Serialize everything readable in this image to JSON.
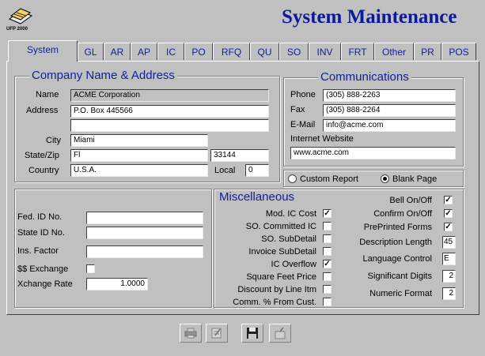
{
  "window": {
    "title": "System Maintenance",
    "logo_text": "UFP 2000"
  },
  "tabs": [
    {
      "label": "System",
      "active": true
    },
    {
      "label": "GL"
    },
    {
      "label": "AR"
    },
    {
      "label": "AP"
    },
    {
      "label": "IC"
    },
    {
      "label": "PO"
    },
    {
      "label": "RFQ"
    },
    {
      "label": "QU"
    },
    {
      "label": "SO"
    },
    {
      "label": "INV"
    },
    {
      "label": "FRT"
    },
    {
      "label": "Other"
    },
    {
      "label": "PR"
    },
    {
      "label": "POS"
    }
  ],
  "company": {
    "title": "Company Name & Address",
    "name_label": "Name",
    "name": "ACME Corporation",
    "address_label": "Address",
    "address1": "P.O. Box 445566",
    "address2": "",
    "city_label": "City",
    "city": "Miami",
    "statezip_label": "State/Zip",
    "state": "Fl",
    "zip": "33144",
    "country_label": "Country",
    "country": "U.S.A.",
    "local_label": "Local",
    "local": "0"
  },
  "communications": {
    "title": "Communications",
    "phone_label": "Phone",
    "phone": "(305) 888-2263",
    "fax_label": "Fax",
    "fax": "(305) 888-2264",
    "email_label": "E-Mail",
    "email": "info@acme.com",
    "website_label": "Internet Website",
    "website": "www.acme.com"
  },
  "report": {
    "custom_label": "Custom Report",
    "blank_label": "Blank Page",
    "selected": "blank"
  },
  "ids": {
    "fed_label": "Fed. ID No.",
    "fed": "",
    "state_label": "State ID No.",
    "state": "",
    "ins_label": "Ins. Factor",
    "ins": "",
    "exchange_label": "$$ Exchange",
    "exchange": false,
    "rate_label": "Xchange Rate",
    "rate": "1.0000"
  },
  "misc": {
    "title": "Miscellaneous",
    "mod_ic_cost": {
      "label": "Mod. IC Cost",
      "checked": true
    },
    "so_committed": {
      "label": "SO. Committed IC",
      "checked": false
    },
    "so_subdetail": {
      "label": "SO. SubDetail",
      "checked": false
    },
    "invoice_subdetail": {
      "label": "Invoice SubDetail",
      "checked": false
    },
    "ic_overflow": {
      "label": "IC Overflow",
      "checked": true
    },
    "square_feet": {
      "label": "Square Feet Price",
      "checked": false
    },
    "discount_line": {
      "label": "Discount by Line Itm",
      "checked": false
    },
    "comm_pct": {
      "label": "Comm. % From Cust.",
      "checked": false
    },
    "bell": {
      "label": "Bell On/Off",
      "checked": true
    },
    "confirm": {
      "label": "Confirm On/Off",
      "checked": true
    },
    "preprinted": {
      "label": "PrePrinted Forms",
      "checked": true
    },
    "desc_length_label": "Description Length",
    "desc_length": "45",
    "lang_label": "Language Control",
    "lang": "E",
    "sig_digits_label": "Significant Digits",
    "sig_digits": "2",
    "numeric_label": "Numeric Format",
    "numeric": "2"
  },
  "toolbar": {
    "check": "✓"
  }
}
